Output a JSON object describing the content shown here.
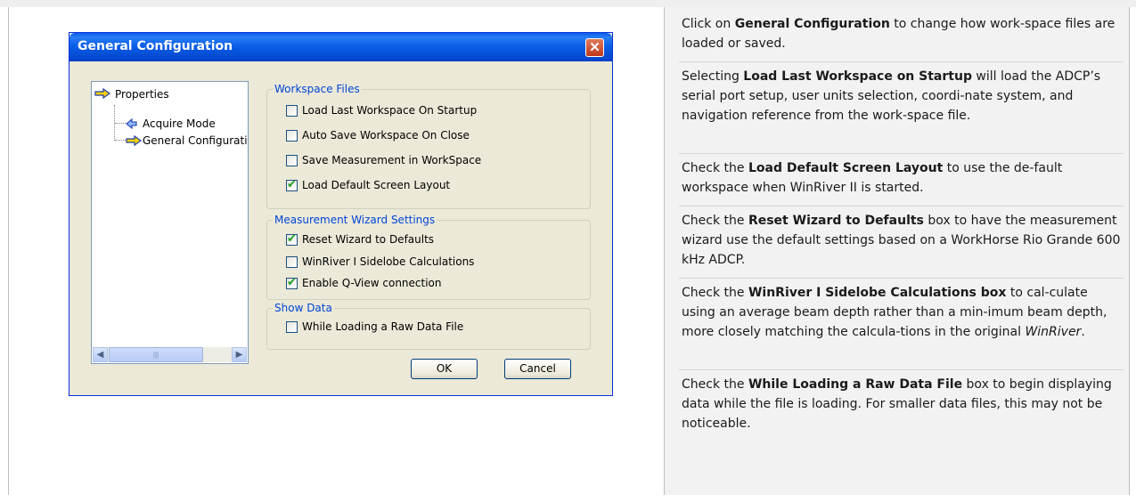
{
  "dialog": {
    "title": "General Configuration",
    "close_glyph": "✕",
    "tree": {
      "root": "Properties",
      "items": [
        "Acquire Mode",
        "General Configuratic"
      ]
    },
    "groups": {
      "workspace_files": {
        "legend": "Workspace Files",
        "options": [
          {
            "label": "Load Last Workspace On Startup",
            "checked": false
          },
          {
            "label": "Auto Save Workspace On Close",
            "checked": false
          },
          {
            "label": "Save Measurement in WorkSpace",
            "checked": false
          },
          {
            "label": "Load Default Screen Layout",
            "checked": true
          }
        ]
      },
      "wizard": {
        "legend": "Measurement Wizard Settings",
        "options": [
          {
            "label": "Reset Wizard to Defaults",
            "checked": true
          },
          {
            "label": "WinRiver I Sidelobe Calculations",
            "checked": false
          },
          {
            "label": "Enable Q-View connection",
            "checked": true
          }
        ]
      },
      "show_data": {
        "legend": "Show Data",
        "options": [
          {
            "label": "While Loading a Raw Data File",
            "checked": false
          }
        ]
      }
    },
    "ok_label": "OK",
    "cancel_label": "Cancel"
  },
  "help": [
    [
      "Click on ",
      "General Configuration",
      " to change how work-space files are loaded or saved."
    ],
    [
      "Selecting ",
      "Load Last Workspace on Startup",
      " will load the ADCP’s serial port setup, user units selection, coordi-nate system, and navigation reference from the work-space file."
    ],
    [
      "Check the ",
      "Load Default Screen Layout",
      " to use the de-fault workspace when WinRiver II is started."
    ],
    [
      "Check the ",
      "Reset Wizard to Defaults",
      " box to have the measurement wizard use the default settings based on a WorkHorse Rio Grande 600 kHz ADCP."
    ],
    [
      "Check the ",
      "WinRiver I Sidelobe Calculations box",
      " to cal-culate using an average beam depth rather than a min-imum beam depth, more closely matching the calcula-tions in the original ",
      "WinRiver",
      "."
    ],
    [
      "Check the ",
      "While Loading a Raw Data File",
      " box to begin displaying data while the file is loading. For smaller data files, this may not be noticeable."
    ]
  ]
}
